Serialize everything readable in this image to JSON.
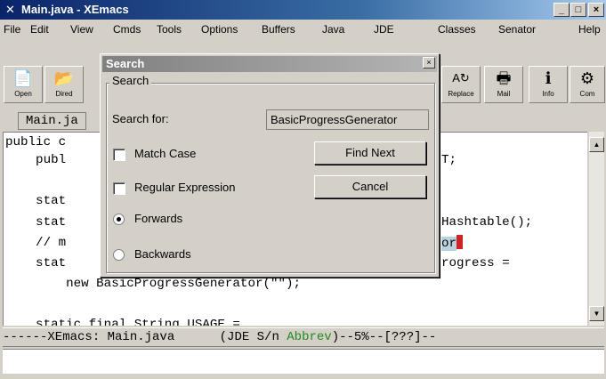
{
  "window": {
    "title": "Main.java - XEmacs",
    "min_label": "_",
    "max_label": "□",
    "close_label": "×"
  },
  "menu": [
    {
      "label": "File"
    },
    {
      "label": "Edit"
    },
    {
      "label": "View"
    },
    {
      "label": "Cmds"
    },
    {
      "label": "Tools"
    },
    {
      "label": "Options"
    },
    {
      "label": "Buffers"
    },
    {
      "label": "Java"
    },
    {
      "label": "JDE"
    },
    {
      "label": "Classes"
    },
    {
      "label": "Senator"
    },
    {
      "label": "Help"
    }
  ],
  "toolbar": [
    {
      "label": "Open",
      "icon": "📄"
    },
    {
      "label": "Dired",
      "icon": "📂"
    },
    {
      "label": "Replace",
      "icon": "A↻"
    },
    {
      "label": "Mail",
      "icon": "🖶"
    },
    {
      "label": "Info",
      "icon": "ℹ"
    },
    {
      "label": "Com",
      "icon": "⚙"
    }
  ],
  "buffer_tab": "Main.ja",
  "code": {
    "l1a": "public c",
    "l2a": "    publ",
    "l2b": "T;",
    "l4a": "    stat",
    "l5a": "    stat",
    "l5b": "Hashtable();",
    "l6a": "    // m",
    "l6b": "or",
    "l7a": "    stat",
    "l7b": "rogress =",
    "l8": "        new BasicProgressGenerator(\"\");",
    "l10": "    static final String USAGE ="
  },
  "modeline": {
    "pre": "------XEmacs: Main.java      (JDE S/n ",
    "abbrev": "Abbrev",
    "post": ")--5%--[???]--"
  },
  "dialog": {
    "title": "Search",
    "group_label": "Search",
    "search_for_label": "Search for:",
    "search_value": "BasicProgressGenerator",
    "match_case": "Match Case",
    "regex": "Regular Expression",
    "forwards": "Forwards",
    "backwards": "Backwards",
    "find_next": "Find Next",
    "cancel": "Cancel",
    "match_case_checked": false,
    "regex_checked": false,
    "direction": "forwards"
  }
}
